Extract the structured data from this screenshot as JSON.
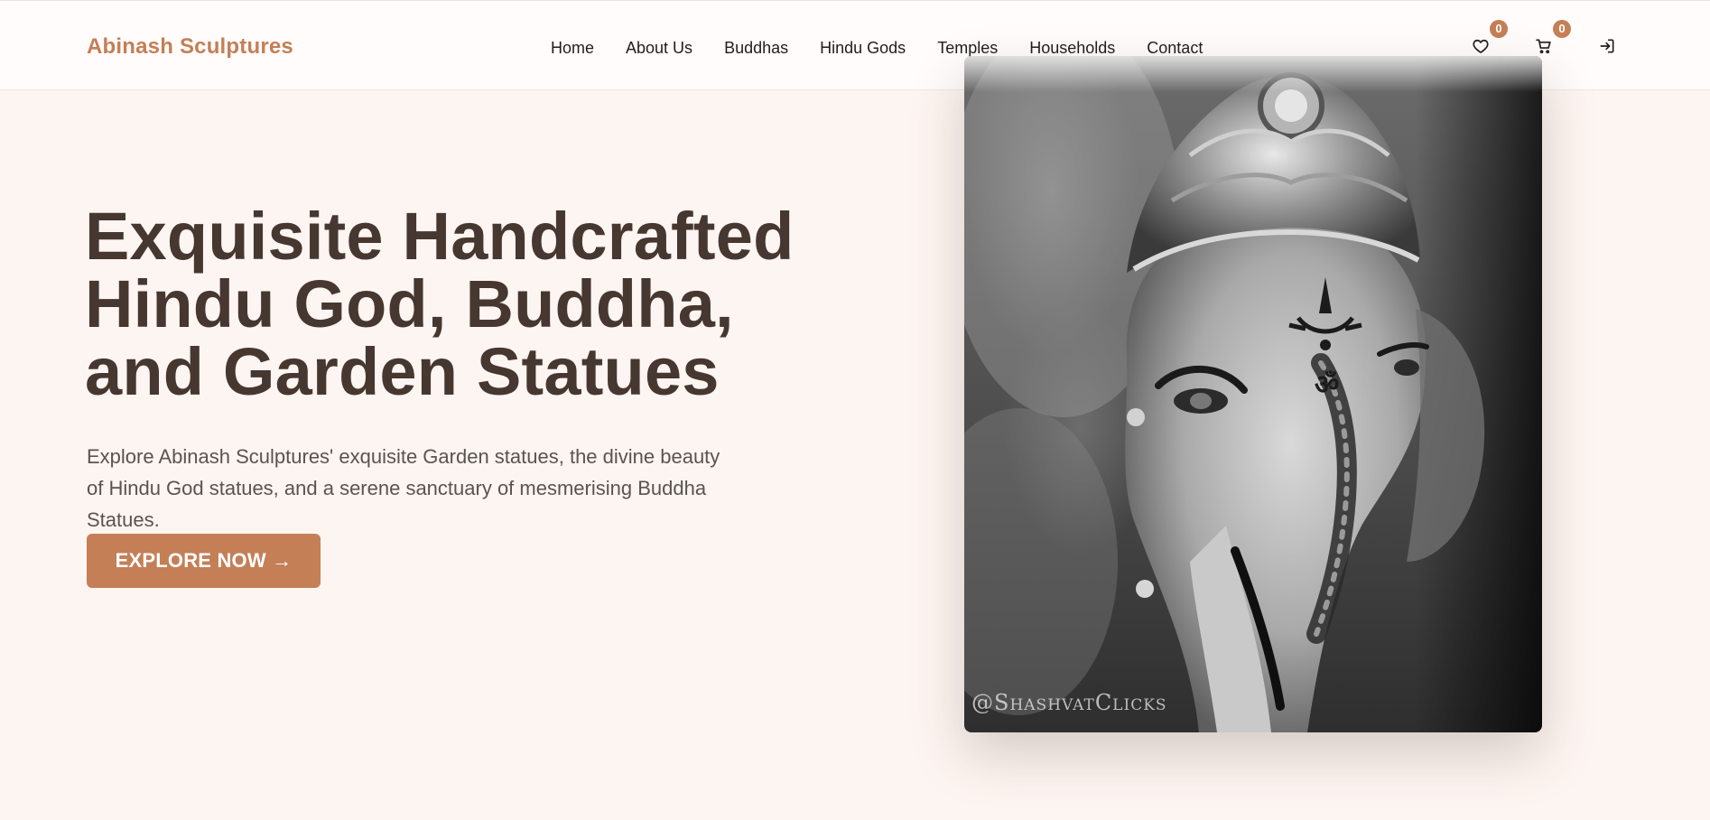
{
  "header": {
    "brand": "Abinash Sculptures",
    "nav": [
      "Home",
      "About Us",
      "Buddhas",
      "Hindu Gods",
      "Temples",
      "Households",
      "Contact"
    ],
    "wishlist": {
      "icon": "heart-icon",
      "count": "0"
    },
    "cart": {
      "icon": "cart-icon",
      "count": "0"
    },
    "login": {
      "icon": "login-icon"
    }
  },
  "hero": {
    "title_lines": [
      "Exquisite Handcrafted",
      "Hindu God, Buddha,",
      "and Garden Statues"
    ],
    "description": "Explore Abinash Sculptures' exquisite Garden statues, the divine beauty of Hindu God statues, and a serene sanctuary of mesmerising Buddha Statues.",
    "cta_label": "EXPLORE NOW →",
    "image": {
      "subject": "ganesha-statue-photo",
      "watermark": "@ShashvatClicks"
    }
  },
  "colors": {
    "accent": "#c47f57",
    "heading": "#463730",
    "background": "#fdf5f1",
    "header_bg": "#fffcfb"
  }
}
